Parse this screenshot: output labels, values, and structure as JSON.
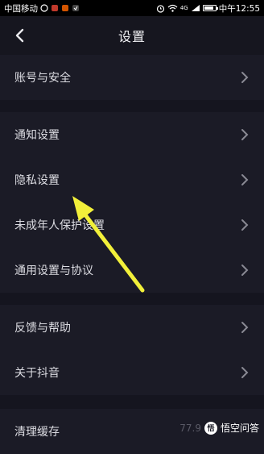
{
  "status_bar": {
    "carrier": "中国移动",
    "network": "4G",
    "time": "中午12:55",
    "battery_level": 0.85
  },
  "header": {
    "title": "设置",
    "back_icon": "chevron-left-icon"
  },
  "groups": [
    {
      "items": [
        {
          "label": "账号与安全"
        }
      ]
    },
    {
      "items": [
        {
          "label": "通知设置"
        },
        {
          "label": "隐私设置"
        },
        {
          "label": "未成年人保护设置"
        },
        {
          "label": "通用设置与协议"
        }
      ]
    },
    {
      "items": [
        {
          "label": "反馈与帮助"
        },
        {
          "label": "关于抖音"
        }
      ]
    },
    {
      "items": [
        {
          "label": "清理缓存"
        }
      ]
    }
  ],
  "annotation": {
    "color": "#f2f03a"
  },
  "watermark": {
    "number": "77.9",
    "text": "悟空问答"
  }
}
